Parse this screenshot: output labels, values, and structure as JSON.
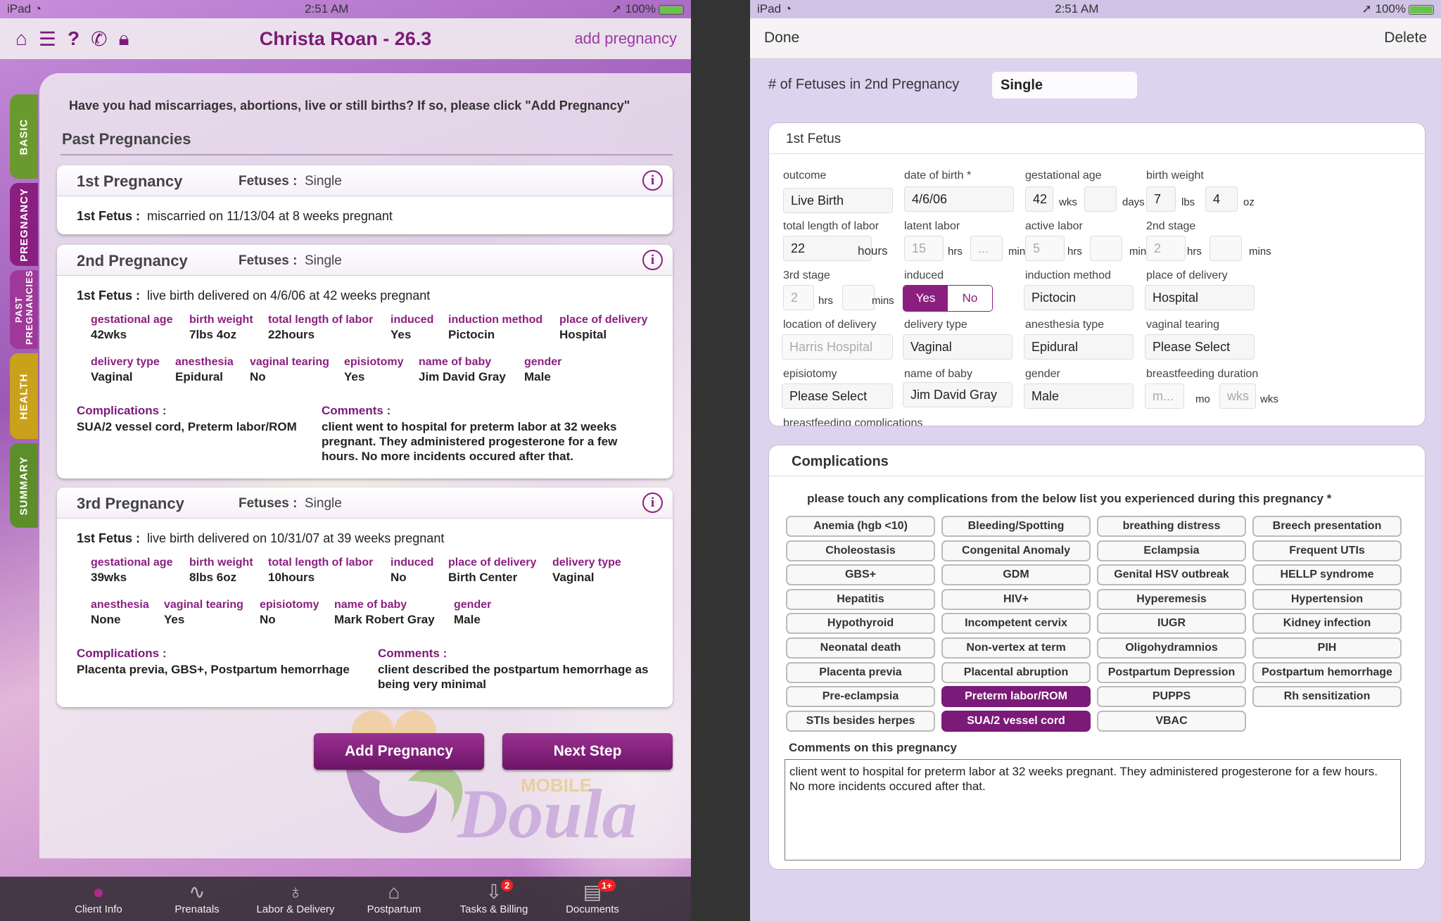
{
  "status": {
    "device": "iPad",
    "time": "2:51 AM",
    "battery": "100%"
  },
  "left": {
    "header": {
      "title": "Christa Roan - 26.3",
      "add": "add pregnancy"
    },
    "side_tabs": [
      "BASIC",
      "PREGNANCY",
      "PAST PREGNANCIES",
      "HEALTH",
      "SUMMARY"
    ],
    "question": "Have you had miscarriages, abortions, live or still births? If so, please click \"Add Pregnancy\"",
    "section_title": "Past Pregnancies",
    "fetuses_label": "Fetuses :",
    "fetus_label": "1st Fetus :",
    "complications_label": "Complications :",
    "comments_label": "Comments :",
    "p1": {
      "name": "1st Pregnancy",
      "fetuses": "Single",
      "line": "miscarried on 11/13/04 at 8 weeks pregnant"
    },
    "p2": {
      "name": "2nd Pregnancy",
      "fetuses": "Single",
      "line": "live birth delivered on 4/6/06 at 42 weeks pregnant",
      "fields": [
        [
          "gestational age",
          "42wks"
        ],
        [
          "birth weight",
          "7lbs 4oz"
        ],
        [
          "total length of labor",
          "22hours"
        ],
        [
          "induced",
          "Yes"
        ],
        [
          "induction method",
          "Pictocin"
        ],
        [
          "place of delivery",
          "Hospital"
        ],
        [
          "delivery type",
          "Vaginal"
        ],
        [
          "anesthesia",
          "Epidural"
        ],
        [
          "vaginal tearing",
          "No"
        ],
        [
          "episiotomy",
          "Yes"
        ],
        [
          "name of baby",
          "Jim David Gray"
        ],
        [
          "gender",
          "Male"
        ]
      ],
      "complications": "SUA/2 vessel cord, Preterm labor/ROM",
      "comments": "client went to hospital for preterm labor at 32 weeks pregnant.  They administered progesterone for a few hours. No more incidents occured after that."
    },
    "p3": {
      "name": "3rd Pregnancy",
      "fetuses": "Single",
      "line": "live birth delivered on 10/31/07 at 39 weeks pregnant",
      "fields": [
        [
          "gestational age",
          "39wks"
        ],
        [
          "birth weight",
          "8lbs 6oz"
        ],
        [
          "total length of labor",
          "10hours"
        ],
        [
          "induced",
          "No"
        ],
        [
          "place of delivery",
          "Birth Center"
        ],
        [
          "delivery type",
          "Vaginal"
        ],
        [
          "anesthesia",
          "None"
        ],
        [
          "vaginal tearing",
          "Yes"
        ],
        [
          "episiotomy",
          "No"
        ],
        [
          "name of baby",
          "Mark Robert Gray"
        ],
        [
          "gender",
          "Male"
        ]
      ],
      "complications": "Placenta previa, GBS+, Postpartum hemorrhage",
      "comments": "client described the postpartum hemorrhage as being very minimal"
    },
    "buttons": {
      "add": "Add Pregnancy",
      "next": "Next Step"
    },
    "logo": {
      "top": "MOBILE",
      "main": "Doula"
    },
    "bottom_tabs": [
      {
        "label": "Client Info"
      },
      {
        "label": "Prenatals"
      },
      {
        "label": "Labor & Delivery"
      },
      {
        "label": "Postpartum"
      },
      {
        "label": "Tasks & Billing",
        "badge": "2"
      },
      {
        "label": "Documents",
        "badge": "1+"
      }
    ]
  },
  "right": {
    "done": "Done",
    "delete": "Delete",
    "num_fetuses_label": "# of Fetuses in 2nd Pregnancy",
    "num_fetuses_value": "Single",
    "fetus_title": "1st Fetus",
    "f": {
      "outcome_l": "outcome",
      "outcome": "Live Birth",
      "dob_l": "date of birth *",
      "dob": "4/6/06",
      "ga_l": "gestational age",
      "ga": "42",
      "ga_days": "",
      "bw_l": "birth weight",
      "bw_lbs": "7",
      "bw_oz": "4",
      "tl_l": "total length of labor",
      "tl": "22",
      "ll_l": "latent labor",
      "ll_h": "15",
      "ll_m": "...",
      "al_l": "active labor",
      "al_h": "5",
      "s2_l": "2nd stage",
      "s2_h": "2",
      "s3_l": "3rd stage",
      "s3_h": "2",
      "ind_l": "induced",
      "ind_yes": "Yes",
      "ind_no": "No",
      "im_l": "induction method",
      "im": "Pictocin",
      "pod_l": "place of delivery",
      "pod": "Hospital",
      "lod_l": "location of delivery",
      "lod": "Harris Hospital",
      "dt_l": "delivery type",
      "dt": "Vaginal",
      "an_l": "anesthesia type",
      "an": "Epidural",
      "vt_l": "vaginal tearing",
      "vt": "Please Select",
      "ep_l": "episiotomy",
      "ep": "Please Select",
      "nb_l": "name of baby",
      "nb": "Jim David Gray",
      "g_l": "gender",
      "g": "Male",
      "bf_l": "breastfeeding duration",
      "bf_mo": "m...",
      "bf_wk": "wks",
      "bfc_l": "breastfeeding complications",
      "u_wks": "wks",
      "u_days": "days",
      "u_lbs": "lbs",
      "u_oz": "oz",
      "u_hours": "hours",
      "u_hrs": "hrs",
      "u_mins": "mins",
      "u_mo": "mo"
    },
    "comp_title": "Complications",
    "comp_instr": "please touch any complications from the below list you experienced during this pregnancy *",
    "complications": [
      "Anemia (hgb <10)",
      "Bleeding/Spotting",
      "breathing distress",
      "Breech presentation",
      "Choleostasis",
      "Congenital Anomaly",
      "Eclampsia",
      "Frequent UTIs",
      "GBS+",
      "GDM",
      "Genital HSV outbreak",
      "HELLP syndrome",
      "Hepatitis",
      "HIV+",
      "Hyperemesis",
      "Hypertension",
      "Hypothyroid",
      "Incompetent cervix",
      "IUGR",
      "Kidney infection",
      "Neonatal death",
      "Non-vertex at term",
      "Oligohydramnios",
      "PIH",
      "Placenta previa",
      "Placental abruption",
      "Postpartum Depression",
      "Postpartum hemorrhage",
      "Pre-eclampsia",
      "Preterm labor/ROM",
      "PUPPS",
      "Rh sensitization",
      "STIs besides herpes",
      "SUA/2 vessel cord",
      "VBAC"
    ],
    "selected": [
      "Preterm labor/ROM",
      "SUA/2 vessel cord"
    ],
    "comments_label": "Comments on this pregnancy",
    "comments": "client went to hospital for preterm labor at 32 weeks pregnant.  They administered progesterone for a few hours. No more incidents occured after that."
  }
}
